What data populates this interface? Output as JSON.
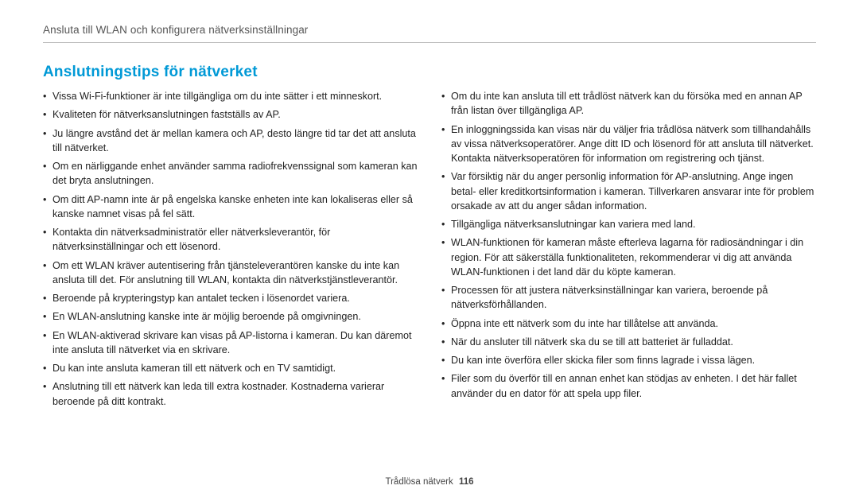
{
  "breadcrumb": "Ansluta till WLAN och konfigurera nätverksinställningar",
  "section_title": "Anslutningstips för nätverket",
  "left_items": [
    "Vissa Wi-Fi-funktioner är inte tillgängliga om du inte sätter i ett minneskort.",
    "Kvaliteten för nätverksanslutningen fastställs av AP.",
    "Ju längre avstånd det är mellan kamera och AP, desto längre tid tar det att ansluta till nätverket.",
    "Om en närliggande enhet använder samma radiofrekvenssignal som kameran kan det bryta anslutningen.",
    "Om ditt AP-namn inte är på engelska kanske enheten inte kan lokaliseras eller så kanske namnet visas på fel sätt.",
    "Kontakta din nätverksadministratör eller nätverksleverantör, för nätverksinställningar och ett lösenord.",
    "Om ett WLAN kräver autentisering från tjänsteleverantören kanske du inte kan ansluta till det. För anslutning till WLAN, kontakta din nätverkstjänstleverantör.",
    "Beroende på krypteringstyp kan antalet tecken i lösenordet variera.",
    "En WLAN-anslutning kanske inte är möjlig beroende på omgivningen.",
    "En WLAN-aktiverad skrivare kan visas på AP-listorna i kameran. Du kan däremot inte ansluta till nätverket via en skrivare.",
    "Du kan inte ansluta kameran till ett nätverk och en TV samtidigt.",
    "Anslutning till ett nätverk kan leda till extra kostnader. Kostnaderna varierar beroende på ditt kontrakt."
  ],
  "right_items": [
    "Om du inte kan ansluta till ett trådlöst nätverk kan du försöka med en annan AP från listan över tillgängliga AP.",
    "En inloggningssida kan visas när du väljer fria trådlösa nätverk som tillhandahålls av vissa nätverksoperatörer. Ange ditt ID och lösenord för att ansluta till nätverket. Kontakta nätverksoperatören för information om registrering och tjänst.",
    "Var försiktig när du anger personlig information för AP-anslutning. Ange ingen betal- eller kreditkortsinformation i kameran. Tillverkaren ansvarar inte för problem orsakade av att du anger sådan information.",
    "Tillgängliga nätverksanslutningar kan variera med land.",
    "WLAN-funktionen för kameran måste efterleva lagarna för radiosändningar i din region. För att säkerställa funktionaliteten, rekommenderar vi dig att använda WLAN-funktionen i det land där du köpte kameran.",
    "Processen för att justera nätverksinställningar kan variera, beroende på nätverksförhållanden.",
    "Öppna inte ett nätverk som du inte har tillåtelse att använda.",
    "När du ansluter till nätverk ska du se till att batteriet är fulladdat.",
    "Du kan inte överföra eller skicka filer som finns lagrade i vissa lägen.",
    "Filer som du överför till en annan enhet kan stödjas av enheten. I det här fallet använder du en dator för att spela upp filer."
  ],
  "footer": {
    "section": "Trådlösa nätverk",
    "page_number": "116"
  }
}
